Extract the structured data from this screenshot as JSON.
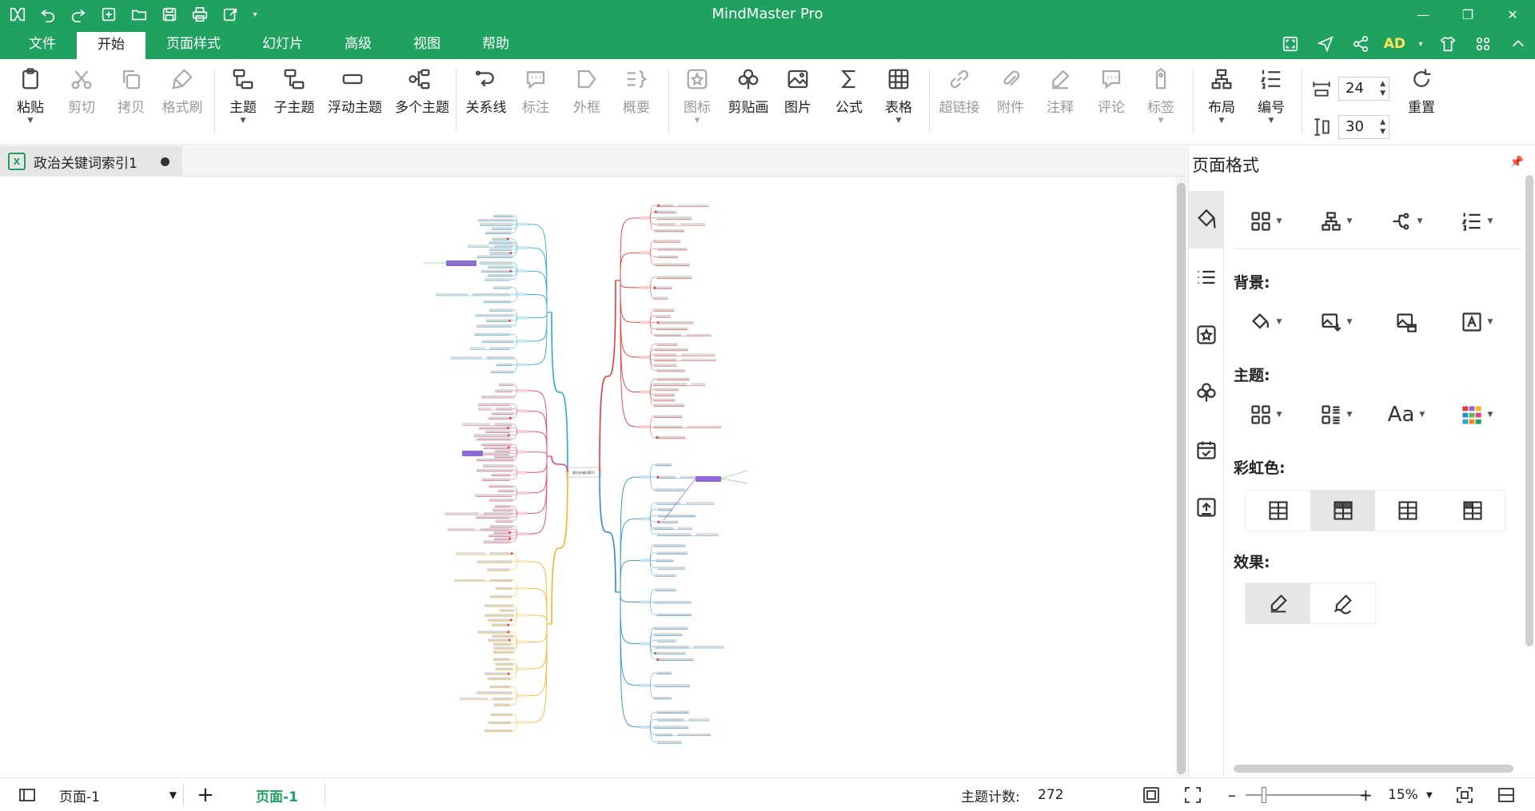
{
  "app": {
    "title": "MindMaster Pro",
    "accent": "#1fa25f"
  },
  "menu": {
    "tabs": [
      "文件",
      "开始",
      "页面样式",
      "幻灯片",
      "高级",
      "视图",
      "帮助"
    ],
    "active": "开始",
    "user": "AD"
  },
  "ribbon": {
    "paste": "粘贴",
    "cut": "剪切",
    "copy": "拷贝",
    "format_painter": "格式刷",
    "topic": "主题",
    "subtopic": "子主题",
    "floating_topic": "浮动主题",
    "multiple_topics": "多个主题",
    "relationship": "关系线",
    "callout": "标注",
    "boundary": "外框",
    "summary": "概要",
    "icon": "图标",
    "clipart": "剪贴画",
    "picture": "图片",
    "formula": "公式",
    "table": "表格",
    "hyperlink": "超链接",
    "attachment": "附件",
    "note": "注释",
    "comment": "评论",
    "tag": "标签",
    "layout": "布局",
    "numbering": "编号",
    "spacing_h": "24",
    "spacing_v": "30",
    "reset": "重置"
  },
  "document": {
    "tab_name": "政治关键词索引1",
    "file_badge": "X",
    "central_topic": "政治关键词索引"
  },
  "panel": {
    "title": "页面格式",
    "background_label": "背景:",
    "theme_label": "主题:",
    "rainbow_label": "彩虹色:",
    "effect_label": "效果:",
    "theme_font_glyph": "Aa"
  },
  "status": {
    "page_select": "页面-1",
    "active_page": "页面-1",
    "topic_count_label": "主题计数:",
    "topic_count": "272",
    "zoom": "15%"
  },
  "mindmap": {
    "branch_colors": [
      "#2aa9d8",
      "#e8437a",
      "#f4b624",
      "#e53b3b",
      "#2c8fc9",
      "#8e6ad8",
      "#5cb85c"
    ]
  }
}
